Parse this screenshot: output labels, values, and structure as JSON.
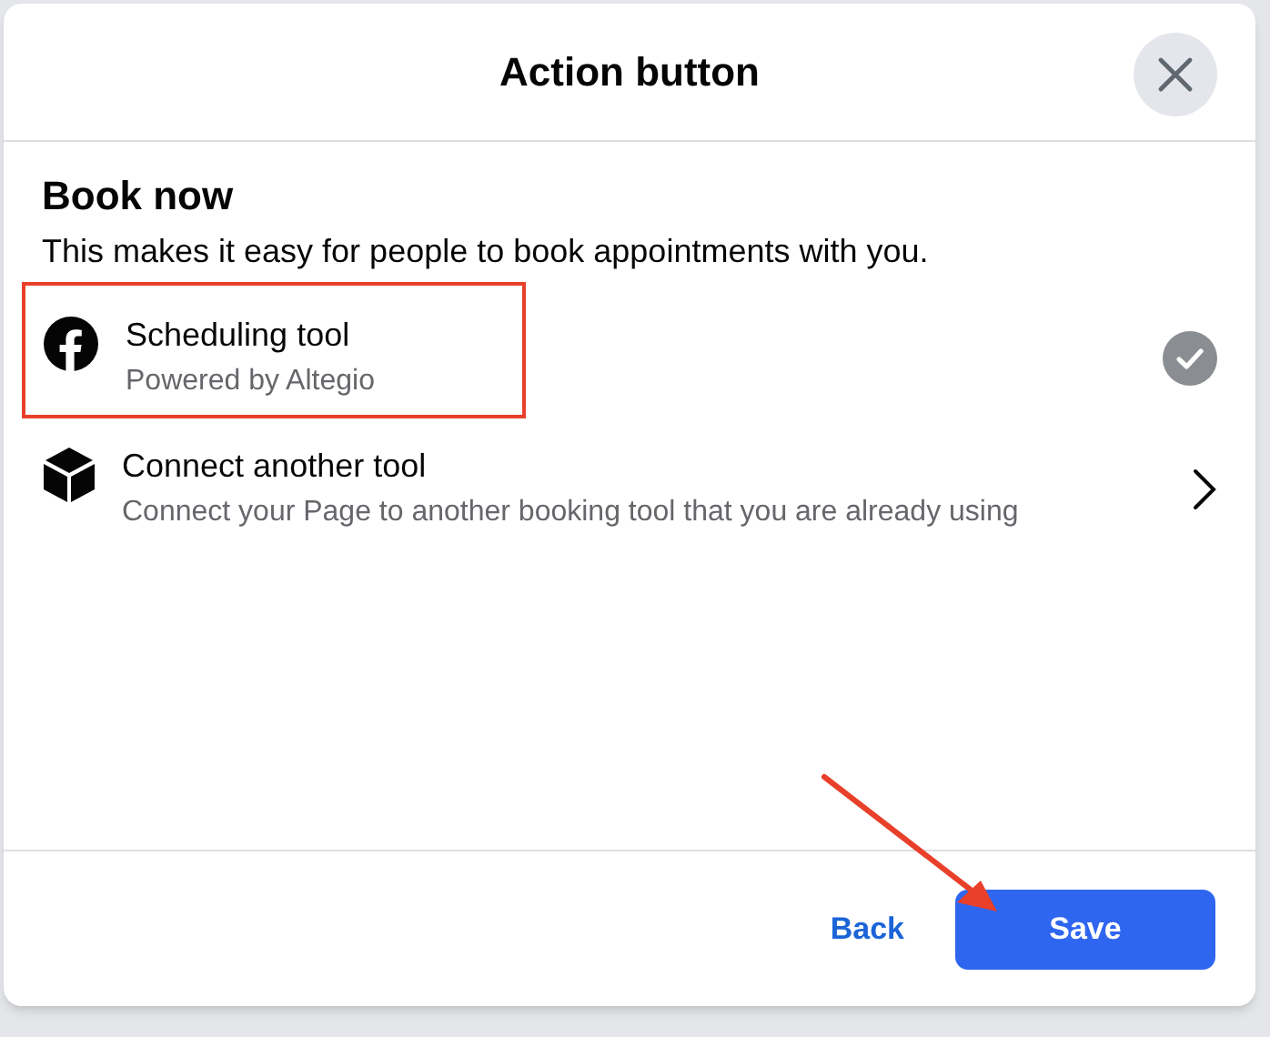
{
  "dialog": {
    "title": "Action button",
    "heading": "Book now",
    "description": "This makes it easy for people to book appointments with you.",
    "options": [
      {
        "kind": "logo",
        "title": "Scheduling tool",
        "subtitle": "Powered by Altegio",
        "selected": true,
        "highlighted": true
      },
      {
        "kind": "cube",
        "title": "Connect another tool",
        "subtitle": "Connect your Page to another booking tool that you are already using",
        "selected": false,
        "highlighted": false
      }
    ],
    "buttons": [
      {
        "kind": "secondary",
        "label": "Back"
      },
      {
        "kind": "primary",
        "label": "Save"
      }
    ]
  }
}
